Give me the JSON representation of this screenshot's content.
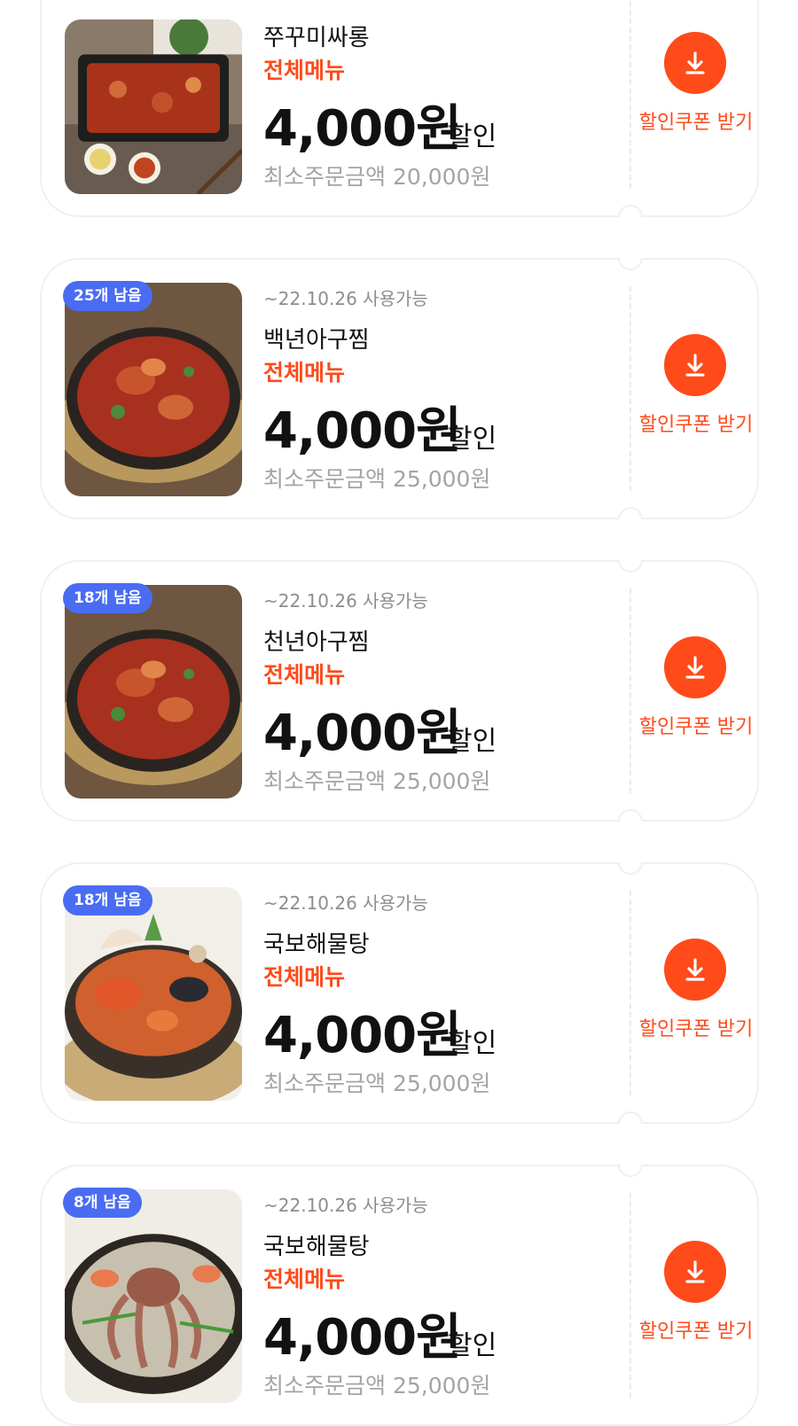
{
  "coupons": [
    {
      "badge": "",
      "expiry": "",
      "store_name": "쭈꾸미싸롱",
      "menu_scope": "전체메뉴",
      "amount": "4,000원",
      "amount_suffix": "할인",
      "min_order": "최소주문금액 20,000원",
      "download_label": "할인쿠폰 받기",
      "image": "spicy-octopus-stir-fry"
    },
    {
      "badge": "25개 남음",
      "expiry": "~22.10.26 사용가능",
      "store_name": "백년아구찜",
      "menu_scope": "전체메뉴",
      "amount": "4,000원",
      "amount_suffix": "할인",
      "min_order": "최소주문금액 25,000원",
      "download_label": "할인쿠폰 받기",
      "image": "braised-monkfish"
    },
    {
      "badge": "18개 남음",
      "expiry": "~22.10.26 사용가능",
      "store_name": "천년아구찜",
      "menu_scope": "전체메뉴",
      "amount": "4,000원",
      "amount_suffix": "할인",
      "min_order": "최소주문금액 25,000원",
      "download_label": "할인쿠폰 받기",
      "image": "braised-monkfish"
    },
    {
      "badge": "18개 남음",
      "expiry": "~22.10.26 사용가능",
      "store_name": "국보해물탕",
      "menu_scope": "전체메뉴",
      "amount": "4,000원",
      "amount_suffix": "할인",
      "min_order": "최소주문금액 25,000원",
      "download_label": "할인쿠폰 받기",
      "image": "seafood-stew"
    },
    {
      "badge": "8개 남음",
      "expiry": "~22.10.26 사용가능",
      "store_name": "국보해물탕",
      "menu_scope": "전체메뉴",
      "amount": "4,000원",
      "amount_suffix": "할인",
      "min_order": "최소주문금액 25,000원",
      "download_label": "할인쿠폰 받기",
      "image": "octopus-hotpot"
    }
  ],
  "colors": {
    "accent": "#ff4a1a",
    "badge": "#4a6cf2",
    "border": "#eef0f6"
  }
}
